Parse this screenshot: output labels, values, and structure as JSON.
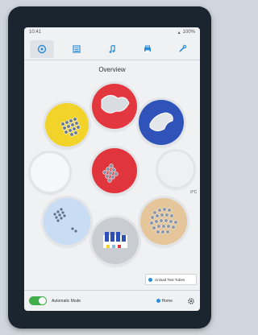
{
  "status": {
    "left": "10:41",
    "right": "100%"
  },
  "tabs": [
    {
      "name": "overview",
      "icon": "target-icon",
      "active": true
    },
    {
      "name": "lists",
      "icon": "list-icon",
      "active": false
    },
    {
      "name": "music",
      "icon": "music-icon",
      "active": false
    },
    {
      "name": "devices",
      "icon": "printer-icon",
      "active": false
    },
    {
      "name": "tools",
      "icon": "wrench-icon",
      "active": false
    }
  ],
  "title": "Overview",
  "side_label": "0°C",
  "unload_button": "Unload Test Tubes",
  "bottom": {
    "toggle_label": "Automatic Mode",
    "home_label": "Home"
  },
  "colors": {
    "accent": "#2d8cd7",
    "toggle": "#3fae4a",
    "yellow": "#f2d32a",
    "red": "#e2373f",
    "blue": "#2f53b8",
    "lightblue": "#c8dcf4",
    "tan": "#e4c69a"
  }
}
